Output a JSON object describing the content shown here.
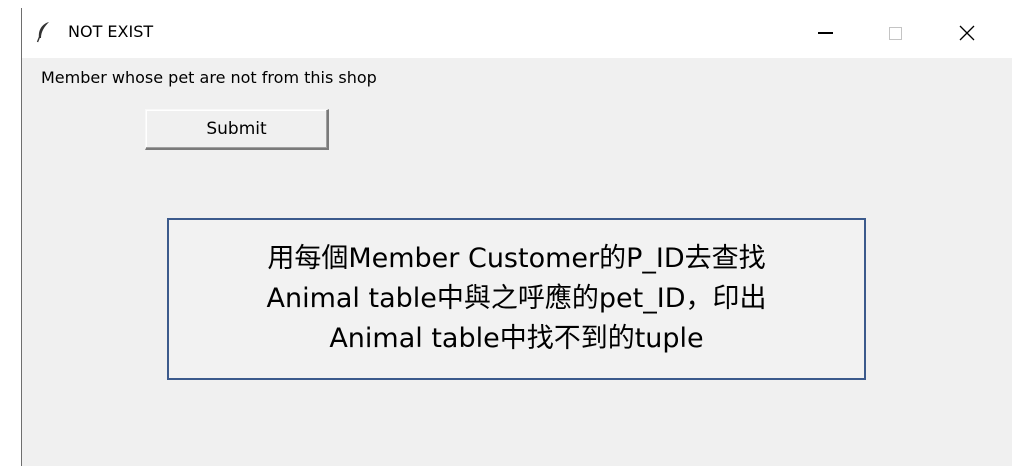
{
  "window": {
    "title": "NOT EXIST",
    "icon": "feather-icon",
    "controls": {
      "minimize": "minimize-icon",
      "maximize": "maximize-icon",
      "close": "close-icon"
    }
  },
  "main": {
    "label": "Member whose pet are not from this shop",
    "submit_label": "Submit"
  },
  "annotation": {
    "lines": [
      "用每個Member Customer的P_ID去查找",
      "Animal table中與之呼應的pet_ID，印出",
      "Animal table中找不到的tuple"
    ]
  },
  "colors": {
    "window_bg": "#f0f0f0",
    "titlebar_bg": "#ffffff",
    "annotation_border": "#3c5a8c"
  }
}
